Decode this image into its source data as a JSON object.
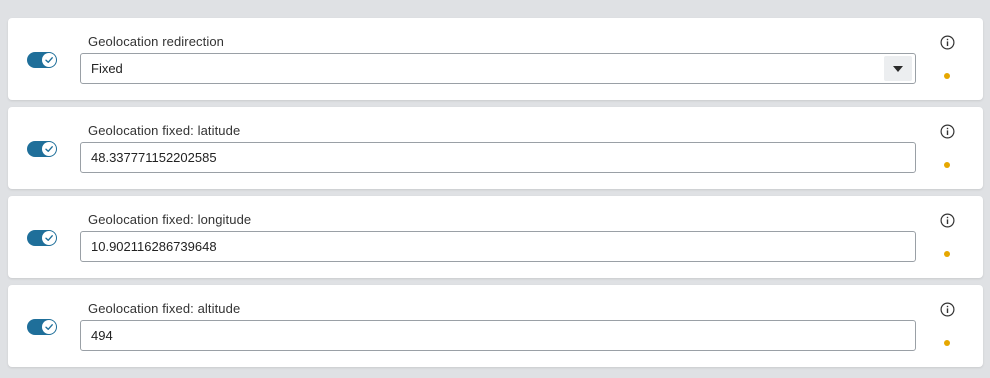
{
  "settings": [
    {
      "label": "Geolocation redirection",
      "type": "select",
      "value": "Fixed",
      "enabled": true,
      "icon_toggle": "check-icon",
      "icon_info": "info-icon",
      "icon_dropdown": "caret-down-icon",
      "status_color": "#e6a700"
    },
    {
      "label": "Geolocation fixed: latitude",
      "type": "text",
      "value": "48.337771152202585",
      "enabled": true,
      "icon_toggle": "check-icon",
      "icon_info": "info-icon",
      "status_color": "#e6a700"
    },
    {
      "label": "Geolocation fixed: longitude",
      "type": "text",
      "value": "10.902116286739648",
      "enabled": true,
      "icon_toggle": "check-icon",
      "icon_info": "info-icon",
      "status_color": "#e6a700"
    },
    {
      "label": "Geolocation fixed: altitude",
      "type": "text",
      "value": "494",
      "enabled": true,
      "icon_toggle": "check-icon",
      "icon_info": "info-icon",
      "status_color": "#e6a700"
    }
  ],
  "colors": {
    "page_background": "#dfe1e4",
    "toggle_on": "#1f6f9a",
    "status_dot": "#e6a700"
  }
}
